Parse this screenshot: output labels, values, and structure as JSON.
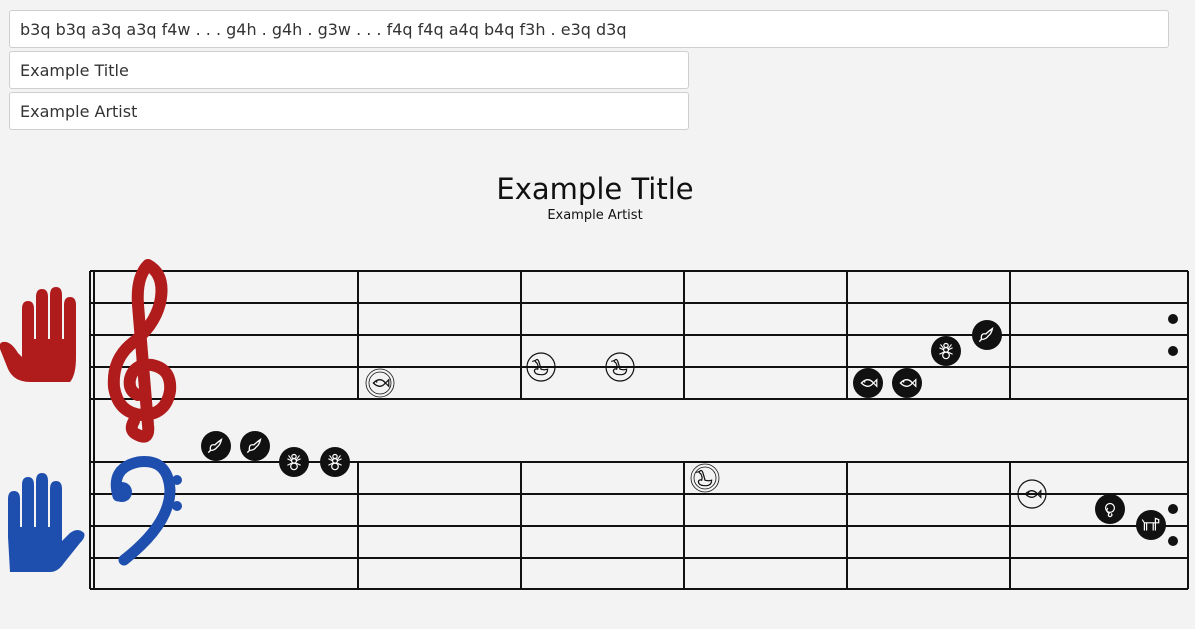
{
  "inputs": {
    "notes": "b3q b3q a3q a3q f4w . . . g4h . g4h . g3w . . . f4q f4q a4q b4q f3h . e3q d3q",
    "title": "Example Title",
    "artist": "Example Artist"
  },
  "song": {
    "title": "Example Title",
    "artist": "Example Artist"
  },
  "colors": {
    "right_hand": "#b01c1c",
    "left_hand": "#1f4fae",
    "ink": "#111111",
    "background": "#f3f3f3"
  },
  "icons": {
    "treble_hand": "right-hand-icon",
    "bass_hand": "left-hand-icon",
    "treble_clef": "treble-clef-icon",
    "bass_clef": "bass-clef-icon"
  },
  "notes": [
    {
      "pitch": "b3",
      "duration": "q",
      "animal": "bird"
    },
    {
      "pitch": "b3",
      "duration": "q",
      "animal": "bird"
    },
    {
      "pitch": "a3",
      "duration": "q",
      "animal": "ant"
    },
    {
      "pitch": "a3",
      "duration": "q",
      "animal": "ant"
    },
    {
      "pitch": "f4",
      "duration": "w",
      "animal": "fish"
    },
    {
      "pitch": "g4",
      "duration": "h",
      "animal": "goose"
    },
    {
      "pitch": "g4",
      "duration": "h",
      "animal": "goose"
    },
    {
      "pitch": "g3",
      "duration": "w",
      "animal": "goose"
    },
    {
      "pitch": "f4",
      "duration": "q",
      "animal": "fish"
    },
    {
      "pitch": "f4",
      "duration": "q",
      "animal": "fish"
    },
    {
      "pitch": "a4",
      "duration": "q",
      "animal": "ant"
    },
    {
      "pitch": "b4",
      "duration": "q",
      "animal": "bird"
    },
    {
      "pitch": "f3",
      "duration": "h",
      "animal": "fish"
    },
    {
      "pitch": "e3",
      "duration": "q",
      "animal": "elephant"
    },
    {
      "pitch": "d3",
      "duration": "q",
      "animal": "dog"
    }
  ]
}
